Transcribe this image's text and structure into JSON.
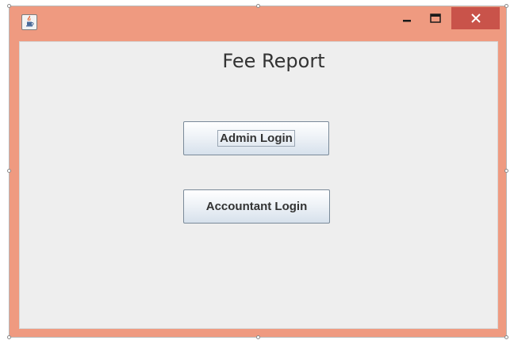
{
  "window": {
    "title_icon": "java-cup-icon",
    "controls": {
      "minimize_icon": "minimize-icon",
      "maximize_icon": "maximize-icon",
      "close_icon": "close-icon"
    },
    "colors": {
      "frame": "#ef9a80",
      "close_button": "#c9534a",
      "content_bg": "#eeeeee"
    }
  },
  "main": {
    "heading": "Fee Report",
    "buttons": {
      "admin_login": "Admin Login",
      "accountant_login": "Accountant Login"
    }
  }
}
